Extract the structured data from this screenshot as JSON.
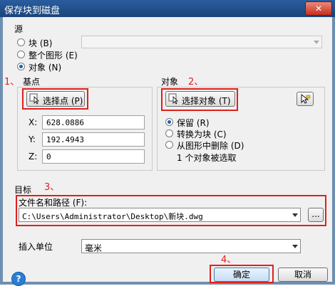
{
  "window": {
    "title": "保存块到磁盘",
    "close_label": "✕"
  },
  "source": {
    "label": "源",
    "options": [
      {
        "label": "块 (B)",
        "selected": false
      },
      {
        "label": "整个图形 (E)",
        "selected": false
      },
      {
        "label": "对象 (N)",
        "selected": true
      }
    ],
    "block_select_value": ""
  },
  "base_point": {
    "label": "基点",
    "pick_button": "选择点 (P)",
    "x_label": "X:",
    "y_label": "Y:",
    "z_label": "Z:",
    "x_value": "628.0886",
    "y_value": "192.4943",
    "z_value": "0"
  },
  "objects": {
    "label": "对象",
    "select_button": "选择对象 (T)",
    "options": [
      {
        "label": "保留 (R)",
        "selected": true
      },
      {
        "label": "转换为块 (C)",
        "selected": false
      },
      {
        "label": "从图形中删除 (D)",
        "selected": false
      }
    ],
    "status": "1 个对象被选取"
  },
  "destination": {
    "label": "目标",
    "path_label": "文件名和路径 (F):",
    "path_value": "C:\\Users\\Administrator\\Desktop\\新块.dwg",
    "browse_label": "...",
    "units_label": "插入单位",
    "units_value": "毫米"
  },
  "footer": {
    "help_label": "?",
    "ok_button": "确定",
    "cancel_button": "取消"
  },
  "annotations": {
    "step1": "1、",
    "step2": "2、",
    "step3": "3、",
    "step4": "4、"
  },
  "colors": {
    "annotation": "#e0201c",
    "selection": "#1d5fb5"
  }
}
